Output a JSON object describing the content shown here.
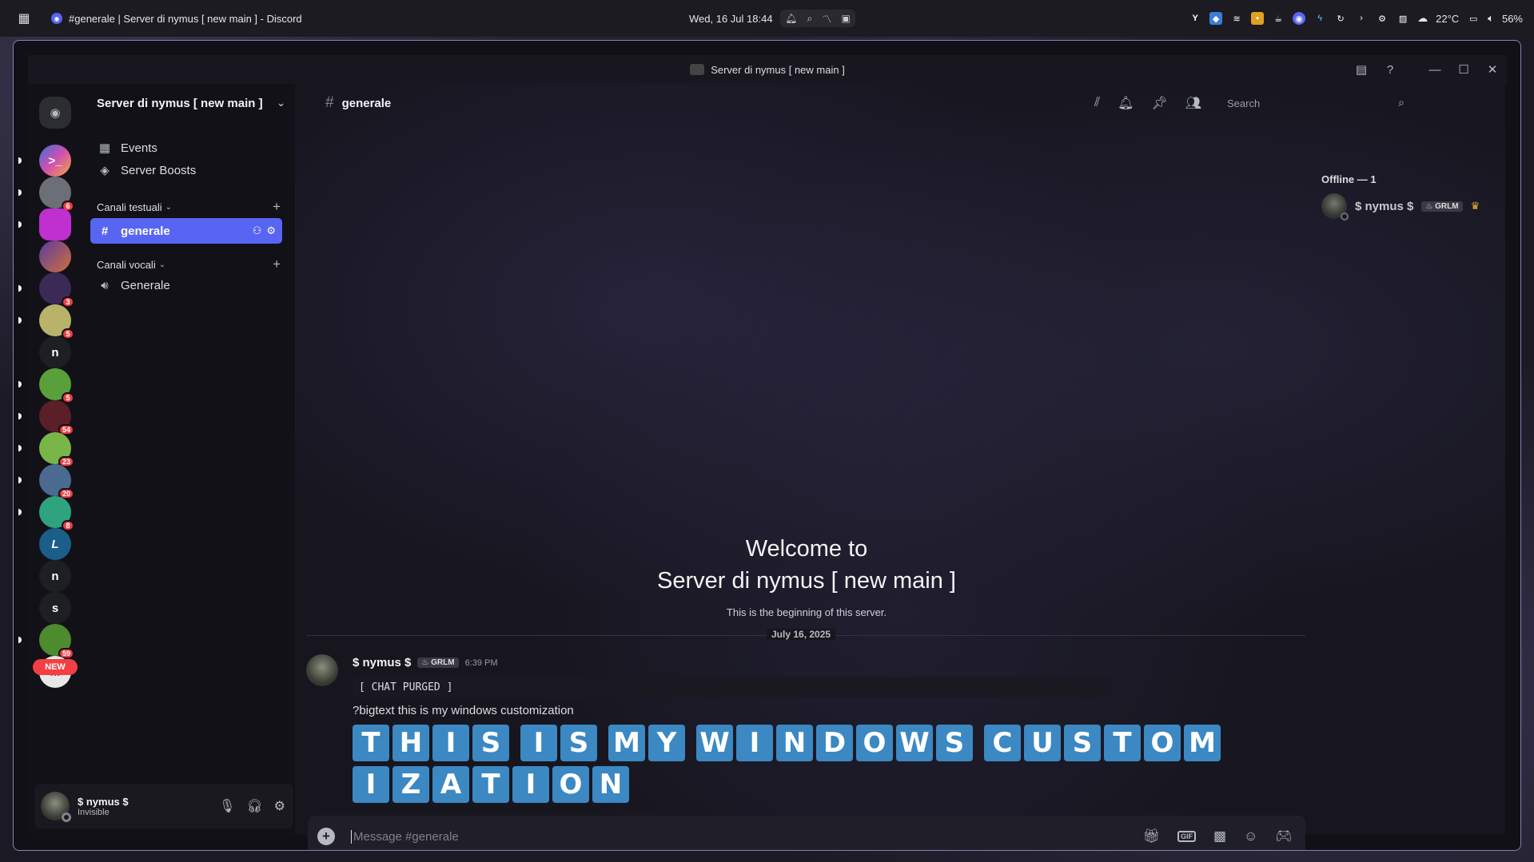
{
  "taskbar": {
    "window_title": "#generale | Server di nymus [ new main ] - Discord",
    "clock": "Wed, 16 Jul 18:44",
    "weather": "22°C",
    "volume": "56%"
  },
  "window": {
    "title": "Server di nymus [ new main ]"
  },
  "guilds": [
    {
      "label": "",
      "color": "#2b2d31",
      "badge": ""
    },
    {
      "label": ">_",
      "color": "#3b6fd6",
      "badge": ""
    },
    {
      "label": "",
      "color": "#6c6f78",
      "badge": "6"
    },
    {
      "label": "",
      "color": "#c02fd0",
      "badge": ""
    },
    {
      "label": "",
      "color": "#7a5bb0",
      "badge": ""
    },
    {
      "label": "",
      "color": "#3a2a55",
      "badge": "3"
    },
    {
      "label": "",
      "color": "#b9b26a",
      "badge": "5"
    },
    {
      "label": "n",
      "color": "#1e1f22",
      "badge": ""
    },
    {
      "label": "",
      "color": "#5aa03a",
      "badge": "5"
    },
    {
      "label": "",
      "color": "#5b1f28",
      "badge": "54"
    },
    {
      "label": "",
      "color": "#7ab548",
      "badge": "23"
    },
    {
      "label": "",
      "color": "#4a6a8f",
      "badge": "20"
    },
    {
      "label": "",
      "color": "#2fa37d",
      "badge": "8"
    },
    {
      "label": "L",
      "color": "#1b5e8a",
      "badge": ""
    },
    {
      "label": "n",
      "color": "#1e1f22",
      "badge": ""
    },
    {
      "label": "s",
      "color": "#1e1f22",
      "badge": ""
    },
    {
      "label": "",
      "color": "#4e8a2e",
      "badge": "59"
    }
  ],
  "new_pill": "NEW",
  "sidebar": {
    "server_name": "Server di nymus [ new main ]",
    "events": "Events",
    "boosts": "Server Boosts",
    "text_category": "Canali testuali",
    "text_channel": "generale",
    "voice_category": "Canali vocali",
    "voice_channel": "Generale"
  },
  "user": {
    "name": "$ nymus $",
    "status": "Invisible"
  },
  "header": {
    "channel": "generale",
    "search_placeholder": "Search"
  },
  "welcome": {
    "line1": "Welcome to",
    "line2": "Server di nymus [ new main ]",
    "subtitle": "This is the beginning of this server."
  },
  "date_divider": "July 16, 2025",
  "message": {
    "author": "$ nymus $",
    "tag": "GRLM",
    "time": "6:39 PM",
    "code": "[ CHAT PURGED ]",
    "text": "?bigtext this is my windows customization",
    "bigtext_rows": [
      [
        "T",
        "H",
        "I",
        "S",
        " ",
        "I",
        "S",
        " ",
        "M",
        "Y",
        " ",
        "W",
        "I",
        "N",
        "D",
        "O",
        "W",
        "S",
        " ",
        "C",
        "U",
        "S",
        "T",
        "O",
        "M"
      ],
      [
        "I",
        "Z",
        "A",
        "T",
        "I",
        "O",
        "N"
      ]
    ]
  },
  "composer": {
    "placeholder": "Message #generale"
  },
  "members": {
    "category": "Offline — 1",
    "name": "$ nymus $",
    "tag": "GRLM"
  }
}
